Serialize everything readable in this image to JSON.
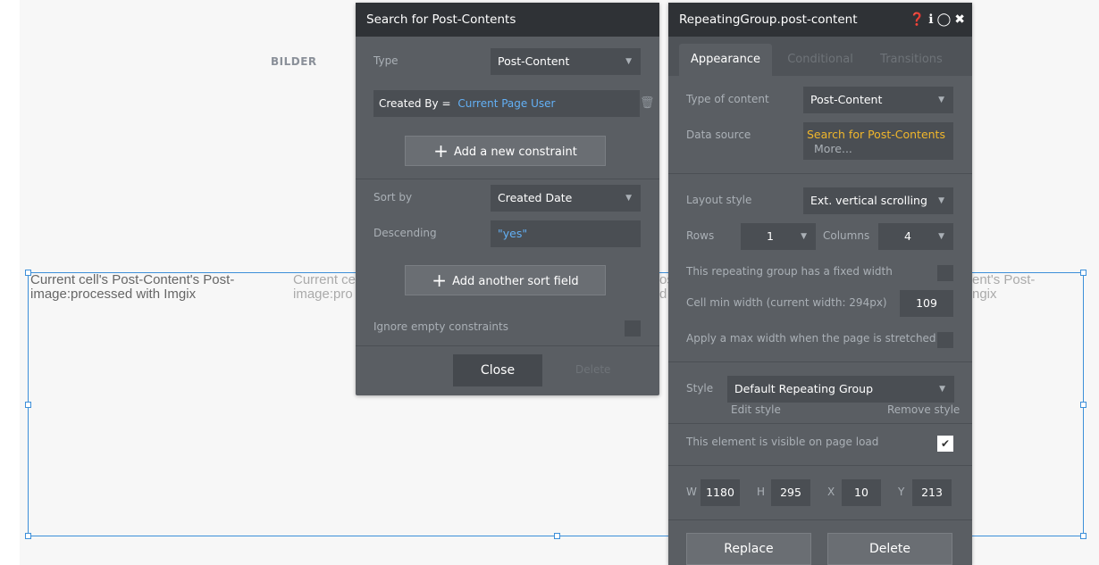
{
  "canvas": {
    "bilder_label": "BILDER",
    "cells": [
      "Current cell's Post-Content's Post-image:processed with Imgix",
      "Current cell's Post-Content's Post-image:processed with Imgix",
      "Current cell's Post-Content's Post-image:processed with Imgix"
    ],
    "cell_fragments": {
      "second": "Current ce\nimage:pro",
      "between": "os\nd",
      "right": "ent's Post-\nngix"
    }
  },
  "search_panel": {
    "title": "Search for Post-Contents",
    "type_label": "Type",
    "type_value": "Post-Content",
    "constraint_key": "Created By =",
    "constraint_value": "Current Page User",
    "add_constraint": "Add a new constraint",
    "sort_by_label": "Sort by",
    "sort_by_value": "Created Date",
    "descending_label": "Descending",
    "descending_value": "\"yes\"",
    "add_sort": "Add another sort field",
    "ignore_empty": "Ignore empty constraints",
    "close": "Close",
    "delete": "Delete"
  },
  "rg_panel": {
    "title": "RepeatingGroup.post-content",
    "tabs": [
      "Appearance",
      "Conditional",
      "Transitions"
    ],
    "type_of_content_label": "Type of content",
    "type_of_content_value": "Post-Content",
    "data_source_label": "Data source",
    "data_source_value": "Search for Post-Contents",
    "data_source_more": "More...",
    "layout_style_label": "Layout style",
    "layout_style_value": "Ext. vertical scrolling",
    "rows_label": "Rows",
    "rows_value": "1",
    "columns_label": "Columns",
    "columns_value": "4",
    "fixed_width_label": "This repeating group has a fixed width",
    "cell_min_width_label": "Cell min width (current width: 294px)",
    "cell_min_width_value": "109",
    "max_width_label": "Apply a max width when the page is stretched",
    "style_label": "Style",
    "style_value": "Default Repeating Group",
    "edit_style": "Edit style",
    "remove_style": "Remove style",
    "visible_label": "This element is visible on page load",
    "w_label": "W",
    "w_value": "1180",
    "h_label": "H",
    "h_value": "295",
    "x_label": "X",
    "x_value": "10",
    "y_label": "Y",
    "y_value": "213",
    "replace": "Replace",
    "delete": "Delete"
  },
  "colors": {
    "accent_blue": "#63b0f5",
    "yellow": "#f0b62b",
    "panel_bg": "#5a5e63",
    "header_bg": "#2f3236",
    "selection_blue": "#3c8fd9"
  }
}
